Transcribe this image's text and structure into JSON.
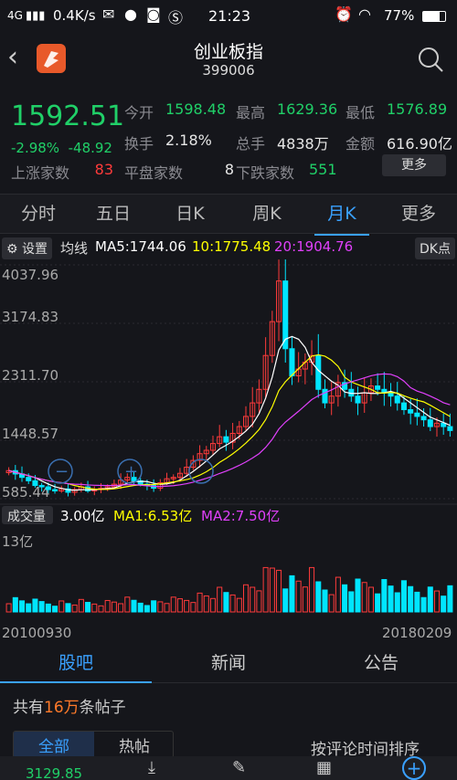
{
  "status_bar": {
    "network": "4G",
    "speed": "0.4K/s",
    "time": "21:23",
    "battery": "77%"
  },
  "header": {
    "title": "创业板指",
    "code": "399006"
  },
  "quote": {
    "price": "1592.51",
    "change_pct": "-2.98%",
    "change_abs": "-48.92",
    "rows": [
      [
        {
          "label": "今开",
          "value": "1598.48",
          "color": "green"
        },
        {
          "label": "最高",
          "value": "1629.36",
          "color": "green"
        },
        {
          "label": "最低",
          "value": "1576.89",
          "color": "green"
        }
      ],
      [
        {
          "label": "换手",
          "value": "2.18%",
          "color": "white"
        },
        {
          "label": "总手",
          "value": "4838万",
          "color": "white"
        },
        {
          "label": "金额",
          "value": "616.90亿",
          "color": "white"
        }
      ],
      [
        {
          "label": "上涨家数",
          "value": "83",
          "color": "red"
        },
        {
          "label": "平盘家数",
          "value": "8",
          "color": "white"
        },
        {
          "label": "下跌家数",
          "value": "551",
          "color": "green"
        }
      ]
    ],
    "more_label": "更多"
  },
  "tabs": [
    "分时",
    "五日",
    "日K",
    "周K",
    "月K",
    "更多"
  ],
  "active_tab": "月K",
  "ma_row": {
    "settings": "设置",
    "label": "均线",
    "ma5": "MA5:1744.06",
    "ma10": "10:1775.48",
    "ma20": "20:1904.76",
    "dk": "DK点"
  },
  "price_axis": [
    "4037.96",
    "3174.83",
    "2311.70",
    "1448.57",
    "585.44"
  ],
  "volume_row": {
    "label": "成交量",
    "vol": "3.00亿",
    "ma1": "MA1:6.53亿",
    "ma2": "MA2:7.50亿",
    "axis_max": "13亿"
  },
  "dates": {
    "start": "20100930",
    "end": "20180209"
  },
  "bottom_tabs": [
    "股吧",
    "新闻",
    "公告"
  ],
  "posts": {
    "prefix": "共有",
    "count": "16万",
    "suffix": "条帖子"
  },
  "sub_tabs": {
    "all": "全部",
    "hot": "热帖",
    "sort": "按评论时间排序"
  },
  "bottom_bar": {
    "index_value": "3129.85"
  },
  "colors": {
    "up": "#ff3b3b",
    "down": "#20d068",
    "accent": "#3aa1ff",
    "vol": "#00e5ff",
    "ma5": "#ffffff",
    "ma10": "#ffff00",
    "ma20": "#e040fb"
  },
  "chart_data": {
    "type": "candlestick",
    "description": "monthly K-line",
    "y_ticks": [
      4037.96,
      3174.83,
      2311.7,
      1448.57,
      585.44
    ],
    "ylim": [
      585.44,
      4037.96
    ],
    "closes": [
      1000,
      950,
      900,
      850,
      780,
      760,
      720,
      700,
      730,
      680,
      720,
      760,
      700,
      720,
      740,
      760,
      800,
      860,
      900,
      850,
      800,
      780,
      740,
      820,
      880,
      900,
      960,
      1050,
      1150,
      1250,
      1300,
      1400,
      1500,
      1420,
      1550,
      1650,
      1800,
      2000,
      2200,
      2700,
      3200,
      3800,
      2800,
      2400,
      2500,
      2600,
      2700,
      2200,
      2000,
      2100,
      2300,
      2200,
      2100,
      2000,
      2150,
      2250,
      2200,
      2150,
      2100,
      2000,
      1900,
      1850,
      1800,
      1750,
      1650,
      1700,
      1650,
      1592
    ],
    "volume_max_label": "13亿"
  }
}
